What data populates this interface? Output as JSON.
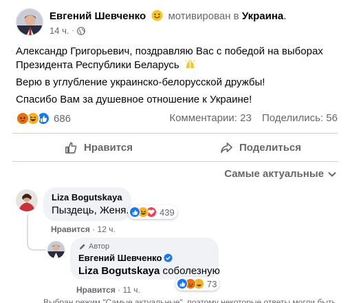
{
  "post": {
    "author": "Евгений Шевченко",
    "feeling_emoji": "smiling-face-icon",
    "feeling_text": "мотивирован в",
    "location": "Украина",
    "location_suffix": ".",
    "time": "14 ч.",
    "separator": "·",
    "audience_icon": "globe-icon",
    "text_lines": [
      "Александр Григорьевич, поздравляю Вас с победой на  выборах",
      "Президента Республики Беларусь",
      "Верю в углубление украинско-белорусской дружбы!",
      "Спасибо Вам за душевное отношение к Украине!"
    ],
    "text_emoji": "raising-hands-icon"
  },
  "reactions": {
    "icons": [
      "angry-icon",
      "haha-icon",
      "like-icon"
    ],
    "count": "686",
    "comments_label": "Комментарии: 23",
    "shares_label": "Поделились: 56"
  },
  "actions": {
    "like_label": "Нравится",
    "share_label": "Поделиться"
  },
  "sort": {
    "label": "Самые актуальные"
  },
  "comments": [
    {
      "author": "Liza Bogutskaya",
      "verified": true,
      "text": "Пыздець, Женя.",
      "reaction_icons": [
        "like-icon",
        "haha-icon",
        "love-icon"
      ],
      "reaction_count": "439",
      "like_label": "Нравится",
      "separator": "·",
      "time": "12 ч."
    },
    {
      "badge": "Автор",
      "author": "Евгений Шевченко",
      "verified": true,
      "mention": "Liza Bogutskaya",
      "text": "соболезную",
      "reaction_icons": [
        "like-icon",
        "angry-icon",
        "haha-icon"
      ],
      "reaction_count": "73",
      "like_label": "Нравится",
      "separator": "·",
      "time": "11 ч."
    }
  ],
  "footer_note": "Выбран режим \"Самые актуальные\", поэтому некоторые ответы могли быть",
  "colors": {
    "like_blue": "#1877f2",
    "angry_orange": "#e9710f",
    "haha_yellow": "#f7b125",
    "love_red": "#f33e58",
    "secondary_text": "#65676b"
  }
}
